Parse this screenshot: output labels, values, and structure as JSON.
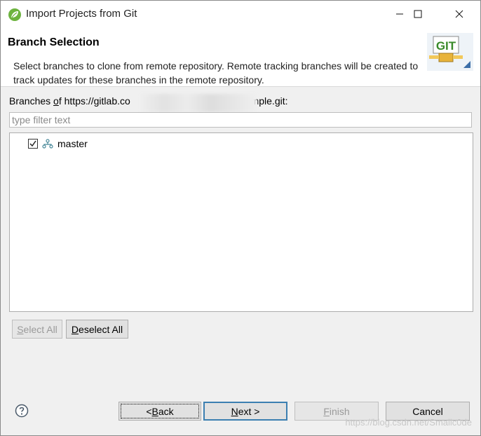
{
  "window": {
    "title": "Import Projects from Git",
    "app_icon": "spring-leaf-icon",
    "controls": [
      "minimize-icon",
      "maximize-icon",
      "close-icon"
    ]
  },
  "header": {
    "title": "Branch Selection",
    "description": "Select branches to clone from remote repository. Remote tracking branches will be created to track updates for these branches in the remote repository.",
    "logo_text": "GIT"
  },
  "branches": {
    "label_prefix": "Branches ",
    "label_mnemonic": "o",
    "label_f": "f ",
    "url_start": "https://gitlab.co",
    "url_end": "ample.git:",
    "filter_placeholder": "type filter text",
    "filter_value": "",
    "items": [
      {
        "name": "master",
        "checked": true,
        "icon": "branch-icon"
      }
    ]
  },
  "selection_buttons": {
    "select_all": {
      "mnemonic": "S",
      "rest": "elect All",
      "enabled": false
    },
    "deselect_all": {
      "mnemonic": "D",
      "rest": "eselect All",
      "enabled": true
    }
  },
  "footer": {
    "help_icon": "help-icon",
    "back": {
      "prefix": "< ",
      "mnemonic": "B",
      "rest": "ack",
      "enabled": true
    },
    "next": {
      "mnemonic": "N",
      "rest": "ext >",
      "enabled": true,
      "default": true
    },
    "finish": {
      "mnemonic": "F",
      "rest": "inish",
      "enabled": false
    },
    "cancel": {
      "label": "Cancel",
      "enabled": true
    }
  },
  "watermark": "https://blog.csdn.net/Smallc0de",
  "colors": {
    "default_button_border": "#3c7fb1",
    "disabled_text": "#9a9a9a",
    "git_logo_green": "#3a8a2a"
  }
}
